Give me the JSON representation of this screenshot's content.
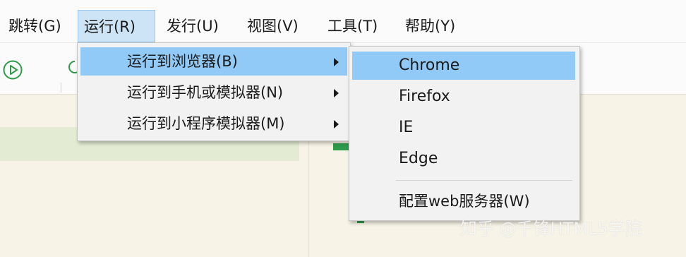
{
  "menubar": {
    "items": [
      {
        "label": "跳转(G)"
      },
      {
        "label": "运行(R)"
      },
      {
        "label": "发行(U)"
      },
      {
        "label": "视图(V)"
      },
      {
        "label": "工具(T)"
      },
      {
        "label": "帮助(Y)"
      }
    ]
  },
  "run_menu": {
    "items": [
      {
        "label": "运行到浏览器(B)"
      },
      {
        "label": "运行到手机或模拟器(N)"
      },
      {
        "label": "运行到小程序模拟器(M)"
      }
    ]
  },
  "browser_submenu": {
    "items": [
      {
        "label": "Chrome"
      },
      {
        "label": "Firefox"
      },
      {
        "label": "IE"
      },
      {
        "label": "Edge"
      },
      {
        "label": "配置web服务器(W)"
      }
    ]
  },
  "watermark": {
    "text": "知乎 @千锋HTML5学院"
  },
  "colors": {
    "menu_highlight": "#91c9f7",
    "active_menubar": "#cde4f7",
    "editor_bg": "#f7f3e6",
    "green": "#2e9a4a"
  }
}
